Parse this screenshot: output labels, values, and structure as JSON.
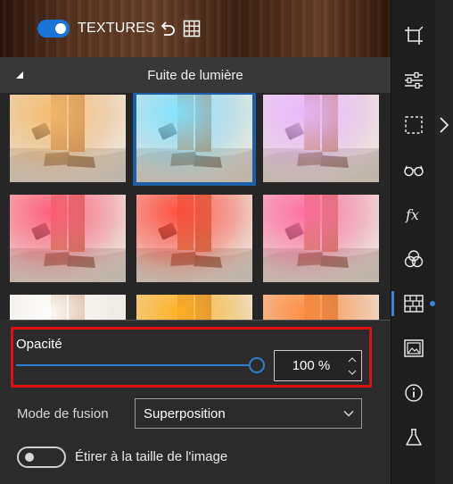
{
  "header": {
    "textures_label": "TEXTURES",
    "textures_enabled": true
  },
  "section": {
    "title": "Fuite de lumière"
  },
  "gallery": {
    "selected_index": 1,
    "thumbnails": [
      {
        "tint": "#f4b96c"
      },
      {
        "tint": "#7fe0ff"
      },
      {
        "tint": "#e9b5ff"
      },
      {
        "tint": "#ff5a7a"
      },
      {
        "tint": "#ff4a3a"
      },
      {
        "tint": "#ff6aa0"
      },
      {
        "tint": "#ffffff"
      },
      {
        "tint": "#ffb020"
      },
      {
        "tint": "#ff8a3d"
      }
    ]
  },
  "opacity": {
    "label": "Opacité",
    "value_text": "100 %",
    "value": 100
  },
  "blend": {
    "label": "Mode de fusion",
    "selected": "Superposition"
  },
  "stretch": {
    "label": "Étirer à la taille de l'image",
    "enabled": false
  },
  "toolbar": {
    "tools": [
      "crop-icon",
      "sliders-icon",
      "selection-icon",
      "glasses-icon",
      "fx-icon",
      "color-circles-icon",
      "texture-icon",
      "frame-icon",
      "info-icon",
      "flask-icon"
    ],
    "active_tool": "texture-icon"
  },
  "colors": {
    "accent": "#1a73d9",
    "highlight_border": "#e01010",
    "selected_thumb_border": "#1d5fa6"
  }
}
